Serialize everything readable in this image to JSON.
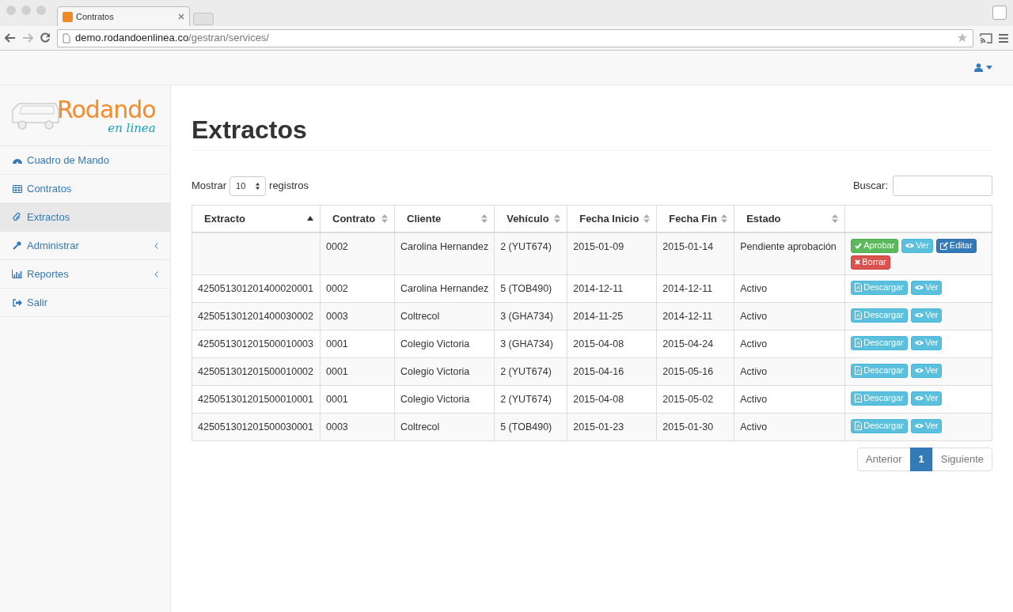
{
  "browser": {
    "tab_title": "Contratos",
    "url_host": "demo.rodandoenlinea.co",
    "url_path": "/gestran/services/"
  },
  "logo": {
    "title": "Rodando",
    "subtitle": "en linea"
  },
  "sidebar": {
    "items": [
      {
        "label": "Cuadro de Mando",
        "selected": false,
        "submenu": false
      },
      {
        "label": "Contratos",
        "selected": false,
        "submenu": false
      },
      {
        "label": "Extractos",
        "selected": true,
        "submenu": false
      },
      {
        "label": "Administrar",
        "selected": false,
        "submenu": true
      },
      {
        "label": "Reportes",
        "selected": false,
        "submenu": true
      },
      {
        "label": "Salir",
        "selected": false,
        "submenu": false
      }
    ]
  },
  "page_title": "Extractos",
  "length": {
    "before": "Mostrar",
    "value": "10",
    "after": "registros"
  },
  "search": {
    "label": "Buscar:"
  },
  "table": {
    "columns": [
      {
        "label": "Extracto",
        "sorted": true
      },
      {
        "label": "Contrato",
        "sorted": false
      },
      {
        "label": "Cliente",
        "sorted": false
      },
      {
        "label": "Vehículo",
        "sorted": false
      },
      {
        "label": "Fecha Inicio",
        "sorted": false
      },
      {
        "label": "Fecha Fin",
        "sorted": false
      },
      {
        "label": "Estado",
        "sorted": false
      }
    ],
    "rows": [
      {
        "cells": [
          "",
          "0002",
          "Carolina Hernandez",
          "2 (YUT674)",
          "2015-01-09",
          "2015-01-14",
          "Pendiente aprobación"
        ],
        "actions": [
          {
            "kind": "approve",
            "label": "Aprobar"
          },
          {
            "kind": "view",
            "label": "Ver"
          },
          {
            "kind": "edit",
            "label": "Editar"
          },
          {
            "kind": "delete",
            "label": "Borrar"
          }
        ]
      },
      {
        "cells": [
          "425051301201400020001",
          "0002",
          "Carolina Hernandez",
          "5 (TOB490)",
          "2014-12-11",
          "2014-12-11",
          "Activo"
        ],
        "actions": [
          {
            "kind": "download",
            "label": "Descargar"
          },
          {
            "kind": "view",
            "label": "Ver"
          }
        ]
      },
      {
        "cells": [
          "425051301201400030002",
          "0003",
          "Coltrecol",
          "3 (GHA734)",
          "2014-11-25",
          "2014-12-11",
          "Activo"
        ],
        "actions": [
          {
            "kind": "download",
            "label": "Descargar"
          },
          {
            "kind": "view",
            "label": "Ver"
          }
        ]
      },
      {
        "cells": [
          "425051301201500010003",
          "0001",
          "Colegio Victoria",
          "3 (GHA734)",
          "2015-04-08",
          "2015-04-24",
          "Activo"
        ],
        "actions": [
          {
            "kind": "download",
            "label": "Descargar"
          },
          {
            "kind": "view",
            "label": "Ver"
          }
        ]
      },
      {
        "cells": [
          "425051301201500010002",
          "0001",
          "Colegio Victoria",
          "2 (YUT674)",
          "2015-04-16",
          "2015-05-16",
          "Activo"
        ],
        "actions": [
          {
            "kind": "download",
            "label": "Descargar"
          },
          {
            "kind": "view",
            "label": "Ver"
          }
        ]
      },
      {
        "cells": [
          "425051301201500010001",
          "0001",
          "Colegio Victoria",
          "2 (YUT674)",
          "2015-04-08",
          "2015-05-02",
          "Activo"
        ],
        "actions": [
          {
            "kind": "download",
            "label": "Descargar"
          },
          {
            "kind": "view",
            "label": "Ver"
          }
        ]
      },
      {
        "cells": [
          "425051301201500030001",
          "0003",
          "Coltrecol",
          "5 (TOB490)",
          "2015-01-23",
          "2015-01-30",
          "Activo"
        ],
        "actions": [
          {
            "kind": "download",
            "label": "Descargar"
          },
          {
            "kind": "view",
            "label": "Ver"
          }
        ]
      }
    ]
  },
  "pagination": [
    {
      "label": "Anterior",
      "selected": false
    },
    {
      "label": "1",
      "selected": true
    },
    {
      "label": "Siguiente",
      "selected": false
    }
  ]
}
